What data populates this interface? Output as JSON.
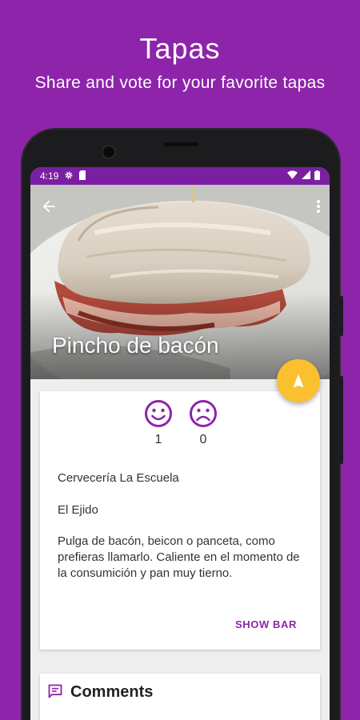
{
  "promo": {
    "title": "Tapas",
    "subtitle": "Share and vote for your favorite tapas"
  },
  "status_bar": {
    "time": "4:19",
    "icons": [
      "gear-icon",
      "sim-icon",
      "wifi-icon",
      "signal-icon",
      "battery-icon"
    ]
  },
  "toolbar": {
    "back_icon": "arrow-back-icon",
    "menu_icon": "more-vert-icon"
  },
  "tapa": {
    "title": "Pincho de bacón",
    "likes": "1",
    "dislikes": "0",
    "bar_name": "Cervecería La Escuela",
    "town": "El Ejido",
    "description": "Pulga de bacón, beicon o panceta, como prefieras llamarlo. Caliente en el momento de la consumición y pan muy tierno.",
    "show_bar_label": "SHOW BAR"
  },
  "comments": {
    "title": "Comments"
  },
  "colors": {
    "background": "#8e24aa",
    "status_bar": "#7b1fa2",
    "accent": "#8e24aa",
    "fab": "#fbc02d"
  }
}
